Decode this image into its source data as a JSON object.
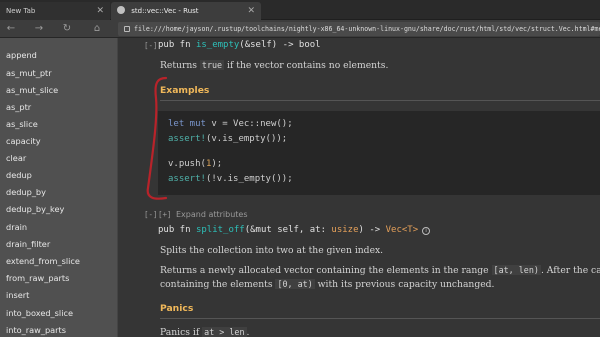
{
  "tabs": [
    {
      "label": "New Tab",
      "close": "✕"
    },
    {
      "label": "std::vec::Vec - Rust",
      "close": "✕"
    }
  ],
  "nav": {
    "back": "←",
    "forward": "→",
    "reload": "↻",
    "home": "⌂",
    "url": "file:///home/jayson/.rustup/toolchains/nightly-x86_64-unknown-linux-gnu/share/doc/rust/html/std/vec/struct.Vec.html#method.is_empty"
  },
  "sidebar": {
    "items": [
      "append",
      "as_mut_ptr",
      "as_mut_slice",
      "as_ptr",
      "as_slice",
      "capacity",
      "clear",
      "dedup",
      "dedup_by",
      "dedup_by_key",
      "drain",
      "drain_filter",
      "extend_from_slice",
      "from_raw_parts",
      "insert",
      "into_boxed_slice",
      "into_raw_parts"
    ]
  },
  "main": {
    "is_empty": {
      "toggle": "[-]",
      "sig_pub": "pub fn ",
      "sig_name": "is_empty",
      "sig_rest": "(&self) -> ",
      "sig_ret": "bool",
      "desc_pre": "Returns ",
      "desc_code": "true",
      "desc_post": " if the vector contains no elements.",
      "examples_heading": "Examples",
      "code": {
        "l1_let": "let mut",
        "l1_rest": " v = Vec::new();",
        "l2_macro": "assert!",
        "l2_rest": "(v.is_empty());",
        "l3_a": "v.push(",
        "l3_num": "1",
        "l3_b": ");",
        "l4_macro": "assert!",
        "l4_rest": "(!v.is_empty());"
      }
    },
    "split_off": {
      "toggle": "[-]",
      "expand_toggle": "[+]",
      "expand_label": "Expand attributes",
      "sig_pub": "pub fn ",
      "sig_name": "split_off",
      "sig_rest": "(&mut self, at: ",
      "sig_usize": "usize",
      "sig_arrow": ") -> ",
      "sig_ret": "Vec<T>",
      "info": "i",
      "desc1": "Splits the collection into two at the given index.",
      "desc2_pre": "Returns a newly allocated vector containing the elements in the range ",
      "desc2_code": "[at, len)",
      "desc2_post": ". After the call, the or",
      "desc3_pre": "containing the elements ",
      "desc3_code": "[0, at)",
      "desc3_post": " with its previous capacity unchanged.",
      "panics_heading": "Panics",
      "panics_pre": "Panics if ",
      "panics_code": "at > len",
      "panics_post": "."
    }
  },
  "annotation_color": "#b8232a"
}
